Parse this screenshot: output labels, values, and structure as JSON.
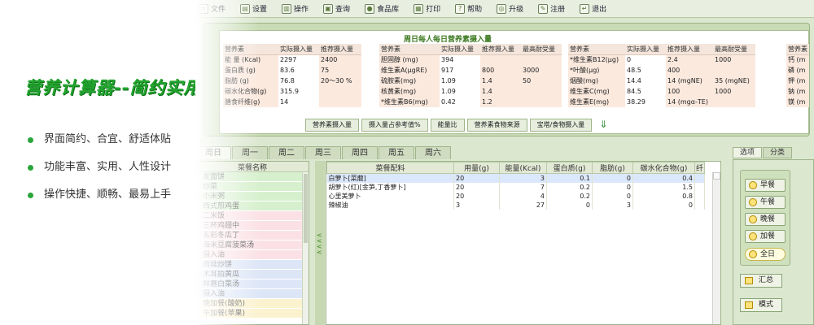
{
  "promo": {
    "title": "营养计算器--简约实用",
    "points": [
      "界面简约、合宜、舒适体贴",
      "功能丰富、实用、人性设计",
      "操作快捷、顺畅、最易上手"
    ]
  },
  "menubar": {
    "items": [
      {
        "label": "文件",
        "icon": "file-icon"
      },
      {
        "label": "设置",
        "icon": "settings-icon"
      },
      {
        "label": "操作",
        "icon": "chart-icon"
      },
      {
        "label": "查询",
        "icon": "query-icon"
      },
      {
        "label": "食品库",
        "icon": "food-library-icon"
      },
      {
        "label": "打印",
        "icon": "print-icon"
      },
      {
        "label": "帮助",
        "icon": "help-icon"
      },
      {
        "label": "升级",
        "icon": "upgrade-icon"
      },
      {
        "label": "注册",
        "icon": "register-icon"
      },
      {
        "label": "退出",
        "icon": "exit-icon"
      }
    ]
  },
  "nutrition": {
    "title": "周日每人每日营养素摄入量",
    "tables": [
      {
        "headers": [
          "营养素",
          "实际摄入量",
          "推荐摄入量"
        ],
        "rows": [
          [
            "能 量 (Kcal)",
            "2297",
            "2400"
          ],
          [
            "蛋白质 (g)",
            "83.6",
            "75"
          ],
          [
            "脂肪 (g)",
            "76.8",
            "20～30 %"
          ],
          [
            "碳水化合物(g)",
            "315.9",
            ""
          ],
          [
            "膳食纤维(g)",
            "14",
            ""
          ]
        ]
      },
      {
        "headers": [
          "营养素",
          "实际摄入量",
          "推荐摄入量",
          "最高耐受量"
        ],
        "rows": [
          [
            "胆固醇 (mg)",
            "394",
            "",
            ""
          ],
          [
            "维生素A(μgRE)",
            "917",
            "800",
            "3000"
          ],
          [
            "硫胺素(mg)",
            "1.09",
            "1.4",
            "50"
          ],
          [
            "核黄素(mg)",
            "1.09",
            "1.4",
            ""
          ],
          [
            "*维生素B6(mg)",
            "0.42",
            "1.2",
            ""
          ]
        ]
      },
      {
        "headers": [
          "营养素",
          "实际摄入量",
          "推荐摄入量",
          "最高耐受量"
        ],
        "rows": [
          [
            "*维生素B12(μg)",
            "0",
            "2.4",
            "1000"
          ],
          [
            "*叶酸(μg)",
            "48.5",
            "400",
            ""
          ],
          [
            "烟酸(mg)",
            "14.4",
            "14 (mgNE)",
            "35 (mgNE)"
          ],
          [
            "维生素C(mg)",
            "84.5",
            "100",
            "1000"
          ],
          [
            "维生素E(mg)",
            "38.29",
            "14 (mgα-TE)",
            ""
          ]
        ]
      },
      {
        "headers": [
          "营养素"
        ],
        "rows": [
          [
            "钙 (m"
          ],
          [
            "磷 (m"
          ],
          [
            "钾 (m"
          ],
          [
            "钠 (m"
          ],
          [
            "镁 (m"
          ]
        ]
      }
    ],
    "tabs": [
      "营养素摄入量",
      "摄入量占参考值%",
      "能量比",
      "营养素食物来源",
      "宝塔/食物摄入量"
    ]
  },
  "days": [
    "周日",
    "周一",
    "周二",
    "周三",
    "周四",
    "周五",
    "周六"
  ],
  "dishes": {
    "header": "菜餐名称",
    "items": [
      {
        "name": "发面饼",
        "color": "g"
      },
      {
        "name": "炒菜",
        "color": "g"
      },
      {
        "name": "小米粥",
        "color": "g"
      },
      {
        "name": "西式煎鸡蛋",
        "color": "g"
      },
      {
        "name": "二米饭",
        "color": "p"
      },
      {
        "name": "三杯鸡翅中",
        "color": "p"
      },
      {
        "name": "五彩冬瓜丁",
        "color": "p"
      },
      {
        "name": "海米豆腐菠菜汤",
        "color": "p"
      },
      {
        "name": "摄入油",
        "color": "p"
      },
      {
        "name": "肉丝炒饼",
        "color": "b"
      },
      {
        "name": "木耳拍黄瓜",
        "color": "b"
      },
      {
        "name": "鲜蘑白菜汤",
        "color": "b"
      },
      {
        "name": "摄入油",
        "color": "b"
      },
      {
        "name": "晚加餐(酸奶)",
        "color": "y"
      },
      {
        "name": "午加餐(苹果)",
        "color": "y"
      }
    ]
  },
  "recipe": {
    "headers": [
      "菜餐配料",
      "用量(g)",
      "能量(Kcal)",
      "蛋白质(g)",
      "脂肪(g)",
      "碳水化合物(g)",
      "纤"
    ],
    "rows": [
      [
        "白萝卜[菜菔]",
        "20",
        "3",
        "0.1",
        "0",
        "0.4"
      ],
      [
        "胡萝卜(红)[金笋,丁香萝卜]",
        "20",
        "7",
        "0.2",
        "0",
        "1.5"
      ],
      [
        "心里美萝卜",
        "20",
        "4",
        "0.2",
        "0",
        "0.8"
      ],
      [
        "辣椒油",
        "3",
        "27",
        "0",
        "3",
        "0"
      ]
    ]
  },
  "side": {
    "tabs": [
      "选项",
      "分类"
    ],
    "meals": [
      "早餐",
      "午餐",
      "晚餐",
      "加餐",
      "全日"
    ],
    "buttons": [
      "汇总",
      "模式"
    ]
  }
}
